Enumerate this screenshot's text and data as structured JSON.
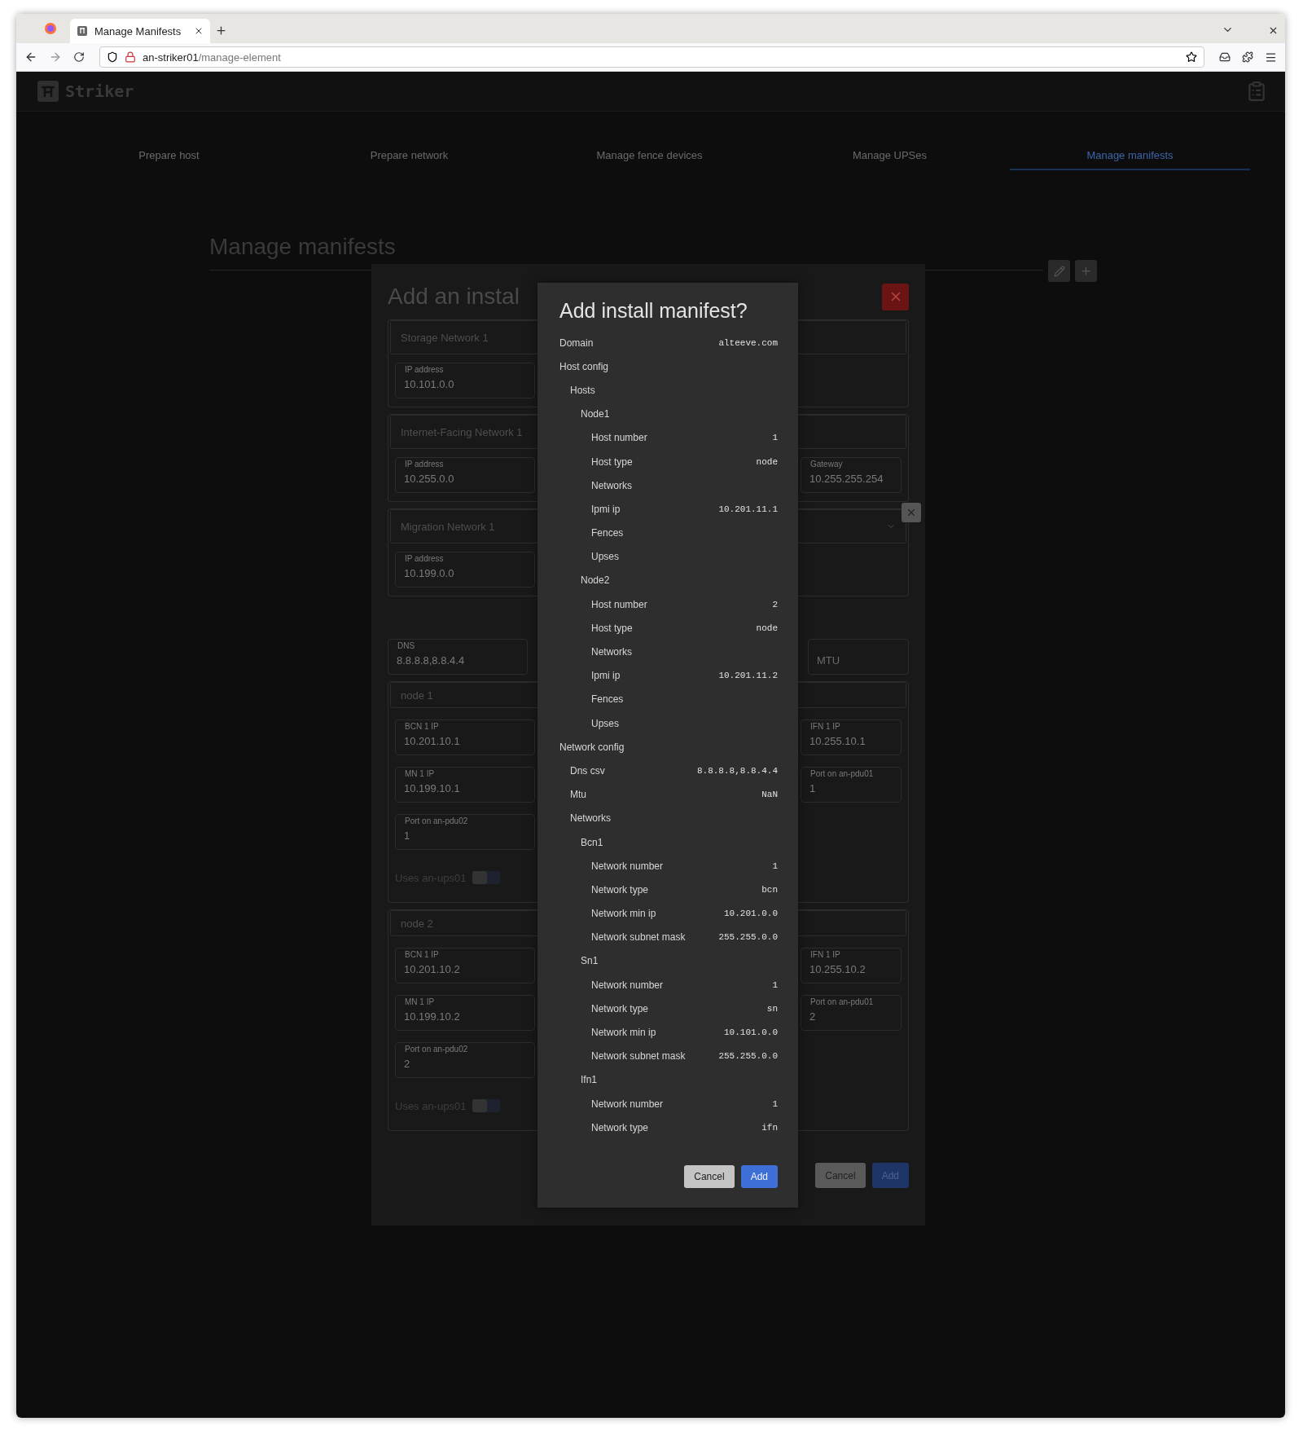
{
  "browser": {
    "tab_title": "Manage Manifests",
    "url_host": "an-striker01",
    "url_path": "/manage-element"
  },
  "header": {
    "logo_text": "Striker"
  },
  "tabs": [
    {
      "label": "Prepare host",
      "selected": false
    },
    {
      "label": "Prepare network",
      "selected": false
    },
    {
      "label": "Manage fence devices",
      "selected": false
    },
    {
      "label": "Manage UPSes",
      "selected": false
    },
    {
      "label": "Manage manifests",
      "selected": true
    }
  ],
  "page_title": "Manage manifests",
  "back_dialog": {
    "title": "Add an instal",
    "networks": [
      {
        "name": "Storage Network 1",
        "ip_label": "IP address",
        "ip": "10.101.0.0",
        "removable": false
      },
      {
        "name": "Internet-Facing Network 1",
        "ip_label": "IP address",
        "ip": "10.255.0.0",
        "gateway_label": "Gateway",
        "gateway": "10.255.255.254",
        "removable": false
      },
      {
        "name": "Migration Network 1",
        "ip_label": "IP address",
        "ip": "10.199.0.0",
        "removable": true
      }
    ],
    "dns_label": "DNS",
    "dns": "8.8.8.8,8.8.4.4",
    "mtu_placeholder": "MTU",
    "hosts": [
      {
        "name": "node 1",
        "bcn_label": "BCN 1 IP",
        "bcn": "10.201.10.1",
        "ifn_label": "IFN 1 IP",
        "ifn": "10.255.10.1",
        "mn_label": "MN 1 IP",
        "mn": "10.199.10.1",
        "pdu1_label": "Port on an-pdu01",
        "pdu1": "1",
        "pdu2_label": "Port on an-pdu02",
        "pdu2": "1",
        "ups_label": "Uses an-ups01",
        "ups_on": false
      },
      {
        "name": "node 2",
        "bcn_label": "BCN 1 IP",
        "bcn": "10.201.10.2",
        "ifn_label": "IFN 1 IP",
        "ifn": "10.255.10.2",
        "mn_label": "MN 1 IP",
        "mn": "10.199.10.2",
        "pdu1_label": "Port on an-pdu01",
        "pdu1": "2",
        "pdu2_label": "Port on an-pdu02",
        "pdu2": "2",
        "ups_label": "Uses an-ups01",
        "ups_on": false
      }
    ],
    "buttons": [
      {
        "label": "Cancel",
        "kind": "secondary"
      },
      {
        "label": "Add",
        "kind": "primary"
      }
    ]
  },
  "confirm_dialog": {
    "title": "Add install manifest?",
    "entries": [
      {
        "label": "Domain",
        "value": "alteeve.com"
      },
      {
        "label": "Host config",
        "children": [
          {
            "label": "Hosts",
            "children": [
              {
                "label": "Node1",
                "children": [
                  {
                    "label": "Host number",
                    "value": "1"
                  },
                  {
                    "label": "Host type",
                    "value": "node"
                  },
                  {
                    "label": "Networks"
                  },
                  {
                    "label": "Ipmi ip",
                    "value": "10.201.11.1"
                  },
                  {
                    "label": "Fences"
                  },
                  {
                    "label": "Upses"
                  }
                ]
              },
              {
                "label": "Node2",
                "children": [
                  {
                    "label": "Host number",
                    "value": "2"
                  },
                  {
                    "label": "Host type",
                    "value": "node"
                  },
                  {
                    "label": "Networks"
                  },
                  {
                    "label": "Ipmi ip",
                    "value": "10.201.11.2"
                  },
                  {
                    "label": "Fences"
                  },
                  {
                    "label": "Upses"
                  }
                ]
              }
            ]
          }
        ]
      },
      {
        "label": "Network config",
        "children": [
          {
            "label": "Dns csv",
            "value": "8.8.8.8,8.8.4.4"
          },
          {
            "label": "Mtu",
            "value": "NaN"
          },
          {
            "label": "Networks",
            "children": [
              {
                "label": "Bcn1",
                "children": [
                  {
                    "label": "Network number",
                    "value": "1"
                  },
                  {
                    "label": "Network type",
                    "value": "bcn"
                  },
                  {
                    "label": "Network min ip",
                    "value": "10.201.0.0"
                  },
                  {
                    "label": "Network subnet mask",
                    "value": "255.255.0.0"
                  }
                ]
              },
              {
                "label": "Sn1",
                "children": [
                  {
                    "label": "Network number",
                    "value": "1"
                  },
                  {
                    "label": "Network type",
                    "value": "sn"
                  },
                  {
                    "label": "Network min ip",
                    "value": "10.101.0.0"
                  },
                  {
                    "label": "Network subnet mask",
                    "value": "255.255.0.0"
                  }
                ]
              },
              {
                "label": "Ifn1",
                "children": [
                  {
                    "label": "Network number",
                    "value": "1"
                  },
                  {
                    "label": "Network type",
                    "value": "ifn"
                  }
                ]
              }
            ]
          }
        ]
      }
    ],
    "buttons": [
      {
        "label": "Cancel",
        "kind": "secondary"
      },
      {
        "label": "Add",
        "kind": "primary"
      }
    ]
  }
}
